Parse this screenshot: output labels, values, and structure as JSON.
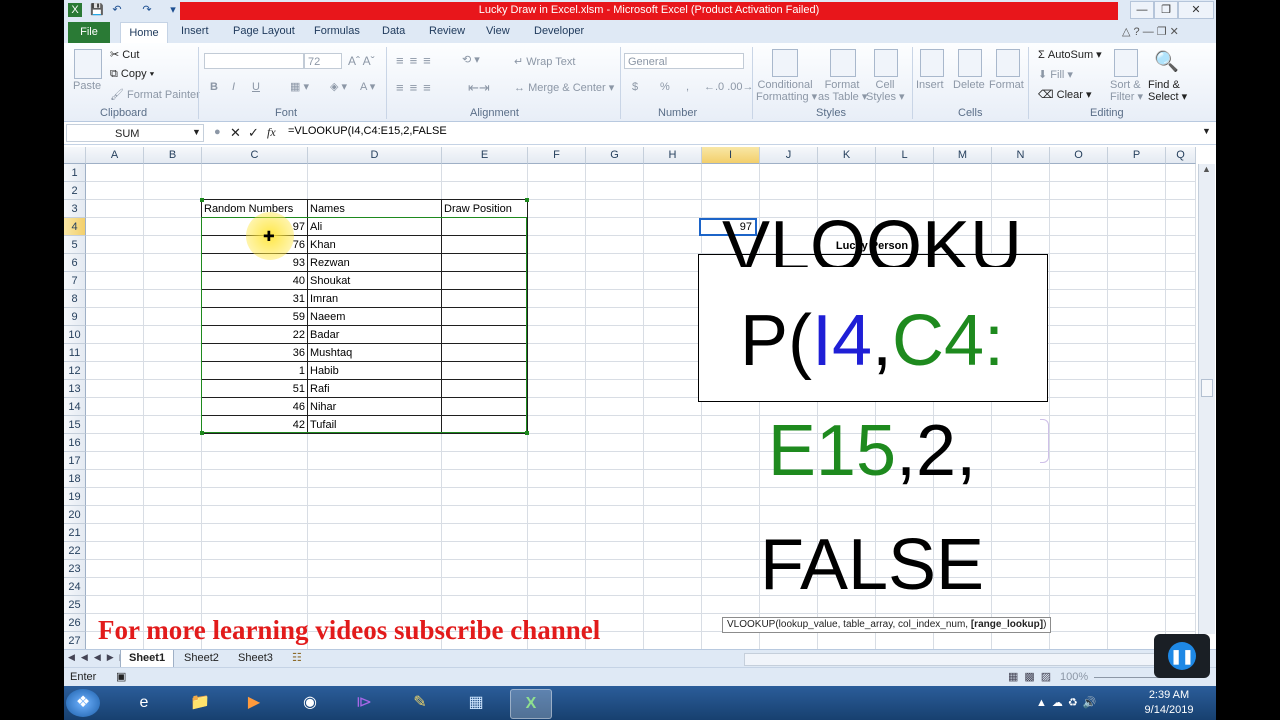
{
  "titlebar": {
    "title": "Lucky Draw in Excel.xlsm  -  Microsoft Excel (Product Activation Failed)"
  },
  "tabs": {
    "file": "File",
    "home": "Home",
    "items": [
      "Insert",
      "Page Layout",
      "Formulas",
      "Data",
      "Review",
      "View",
      "Developer"
    ]
  },
  "ribbon": {
    "clipboard": {
      "paste": "Paste",
      "cut": "Cut",
      "copy": "Copy",
      "format_painter": "Format Painter",
      "label": "Clipboard"
    },
    "font": {
      "size": "72",
      "bold": "B",
      "italic": "I",
      "underline": "U",
      "label": "Font"
    },
    "alignment": {
      "wrap": "Wrap Text",
      "merge": "Merge & Center",
      "label": "Alignment"
    },
    "number": {
      "format": "General",
      "currency": "$",
      "percent": "%",
      "comma": ",",
      "label": "Number"
    },
    "styles": {
      "conditional": [
        "Conditional",
        "Formatting"
      ],
      "format_table": [
        "Format",
        "as Table"
      ],
      "cell_styles": [
        "Cell",
        "Styles"
      ],
      "label": "Styles"
    },
    "cells": {
      "insert": "Insert",
      "delete": "Delete",
      "format": "Format",
      "label": "Cells"
    },
    "editing": {
      "autosum": "AutoSum",
      "fill": "Fill",
      "clear": "Clear",
      "sort": [
        "Sort &",
        "Filter"
      ],
      "find": [
        "Find &",
        "Select"
      ],
      "label": "Editing"
    }
  },
  "formula_bar": {
    "name_box": "SUM",
    "fx": "fx",
    "formula": "=VLOOKUP(I4,C4:E15,2,FALSE"
  },
  "columns": [
    "A",
    "B",
    "C",
    "D",
    "E",
    "F",
    "G",
    "H",
    "I",
    "J",
    "K",
    "L",
    "M",
    "N",
    "O",
    "P",
    "Q"
  ],
  "rows": [
    "1",
    "2",
    "3",
    "4",
    "5",
    "6",
    "7",
    "8",
    "9",
    "10",
    "11",
    "12",
    "13",
    "14",
    "15",
    "16",
    "17",
    "18",
    "19",
    "20",
    "21",
    "22",
    "23",
    "24",
    "25",
    "26",
    "27"
  ],
  "table": {
    "headers": [
      "Random Numbers",
      "Names",
      "Draw Position"
    ],
    "rows": [
      [
        "97",
        "Ali"
      ],
      [
        "76",
        "Khan"
      ],
      [
        "93",
        "Rezwan"
      ],
      [
        "40",
        "Shoukat"
      ],
      [
        "31",
        "Imran"
      ],
      [
        "59",
        "Naeem"
      ],
      [
        "22",
        "Badar"
      ],
      [
        "36",
        "Mushtaq"
      ],
      [
        "1",
        "Habib"
      ],
      [
        "51",
        "Rafi"
      ],
      [
        "46",
        "Nihar"
      ],
      [
        "42",
        "Tufail"
      ]
    ]
  },
  "lookup_cell": "97",
  "lucky_label": "Lucky Person",
  "big_formula": {
    "l1": "VLOOKU",
    "l2_a": "P(",
    "l2_b": "I4",
    "l2_c": ",",
    "l2_d": "C4:",
    "l3_a": "E15",
    "l3_b": ",2,",
    "l4": "FALSE"
  },
  "tooltip": {
    "text": "VLOOKUP(lookup_value, table_array, col_index_num, ",
    "bold": "[range_lookup]",
    "close": ")"
  },
  "watermark": "For more learning videos subscribe channel",
  "sheets": [
    "Sheet1",
    "Sheet2",
    "Sheet3"
  ],
  "status": {
    "mode": "Enter",
    "zoom": "100%"
  },
  "clock": {
    "time": "2:39 AM",
    "date": "9/14/2019"
  },
  "colors": {
    "excel_green": "#2a7a35",
    "title_red": "#e8161b",
    "formula_blue": "#1f1fd6",
    "formula_green": "#1e8a1e"
  }
}
